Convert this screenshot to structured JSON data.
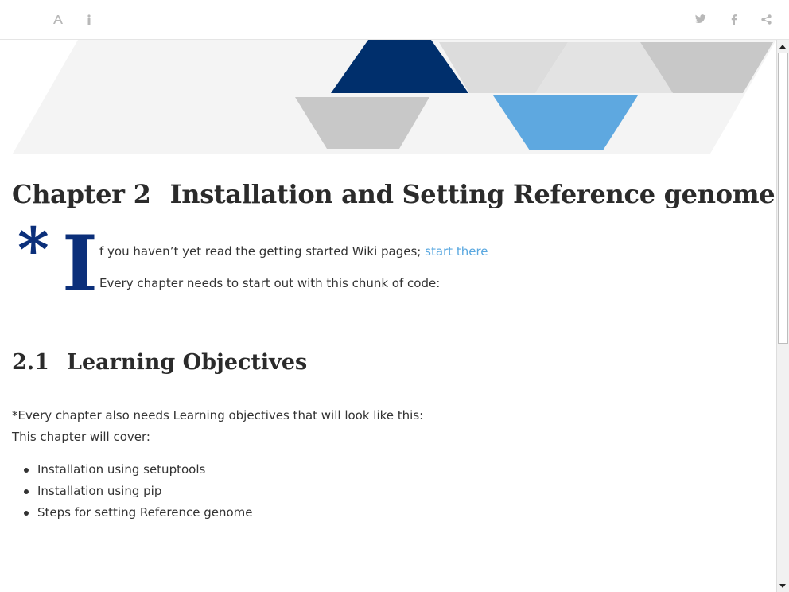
{
  "toolbar": {
    "left_icons": [
      "font-settings-icon",
      "info-icon"
    ],
    "right_icons": [
      "twitter-icon",
      "facebook-icon",
      "share-icon"
    ]
  },
  "colors": {
    "dark_blue": "#002f6c",
    "light_blue": "#5ea8e0",
    "gray_shape": "#c8c8c8",
    "link": "#5aa8e0",
    "heading": "#2b2b2b",
    "dropcap": "#0b2f7a"
  },
  "chapter": {
    "number": "Chapter 2",
    "title": "Installation and Setting Reference genome"
  },
  "intro": {
    "dropcap_star": "*",
    "dropcap_letter": "I",
    "text_before_link": "f you haven’t yet read the getting started Wiki pages; ",
    "link_text": "start there",
    "chunk_text": "Every chapter needs to start out with this chunk of code:"
  },
  "section": {
    "number": "2.1",
    "title": "Learning Objectives"
  },
  "objectives_intro": "*Every chapter also needs Learning objectives that will look like this:",
  "objectives_lead": "This chapter will cover:",
  "objectives": [
    "Installation using setuptools",
    "Installation using pip",
    "Steps for setting Reference genome"
  ]
}
